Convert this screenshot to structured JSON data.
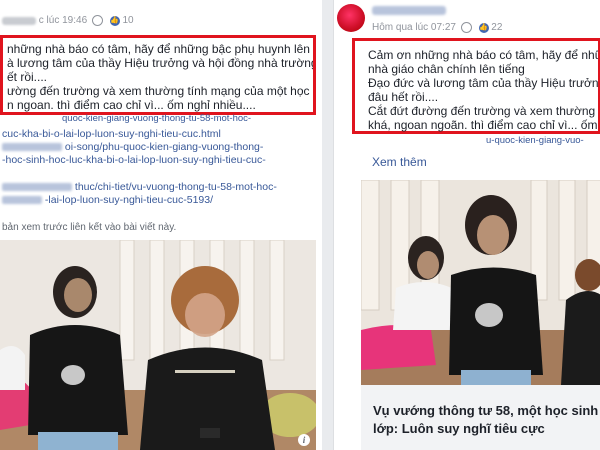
{
  "left_post": {
    "timestamp": "c lúc 19:46",
    "like_count": "10",
    "text_lines": [
      "những nhà báo có tâm, hãy để những bậc phụ huynh lên tiếng",
      "à lương tâm của thầy Hiệu trưởng và hội đồng nhà trường bị",
      "ết rồi....",
      "ường đến trường và xem thường tính mạng của một học sinh",
      "n ngoan. thì điểm cao chỉ vì... ốm nghỉ nhiều...."
    ],
    "links": [
      "cuc-kha-bi-o-lai-lop-luon-suy-nghi-tieu-cuc.html",
      "oi-song/phu-quoc-kien-giang-vuong-thong-",
      "-hoc-sinh-hoc-luc-kha-bi-o-lai-lop-luon-suy-nghi-tieu-cuc-",
      "thuc/chi-tiet/vu-vuong-thong-tu-58-mot-hoc-",
      "-lai-lop-luon-suy-nghi-tieu-cuc-5193/"
    ],
    "partial_link": "quoc-kien-giang-vuong-thong-tu-58-mot-hoc-",
    "preview_note": "bản xem trước liên kết vào bài viết này."
  },
  "right_post": {
    "timestamp": "Hôm qua lúc 07:27",
    "like_count": "22",
    "text_lines": [
      "Cảm ơn những nhà báo có tâm, hãy để những",
      "nhà giáo chân chính lên tiếng",
      "Đạo đức và lương tâm của thầy Hiệu trưởng v",
      "đâu hết rồi....",
      "Cắt đứt đường đến trường và xem thường tính",
      "khá, ngoan ngoãn. thì điểm cao chỉ vì... ốm ng"
    ],
    "see_more": "Xem thêm",
    "link_fragment": "u-quoc-kien-giang-vuo-",
    "article_title_lines": [
      "Vụ vướng thông tư 58, một học sinh h",
      "lớp: Luôn suy nghĩ tiêu cực"
    ]
  },
  "colors": {
    "highlight_border": "#e0141e",
    "link": "#385898",
    "background": "#e9ebee"
  },
  "icons": {
    "globe": "globe-icon",
    "like": "like-icon",
    "info": "info-icon"
  }
}
